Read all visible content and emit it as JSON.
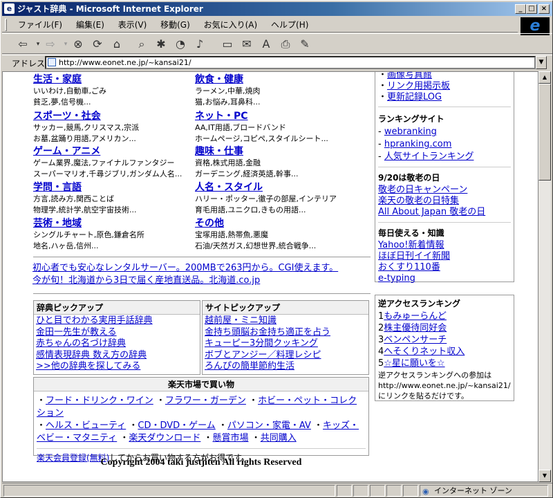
{
  "window": {
    "title": "ジャスト辞典 - Microsoft Internet Explorer",
    "min": "_",
    "max": "□",
    "close": "×"
  },
  "menu": [
    "ファイル(F)",
    "編集(E)",
    "表示(V)",
    "移動(G)",
    "お気に入り(A)",
    "ヘルプ(H)"
  ],
  "address": {
    "label": "アドレス",
    "url": "http://www.eonet.ne.jp/~kansai21/"
  },
  "categories": [
    {
      "title": "生活・家庭",
      "lines": [
        "いいわけ,自動車,ごみ",
        "貧乏,夢,信号機..."
      ]
    },
    {
      "title": "飲食・健康",
      "lines": [
        "ラーメン,中華,焼肉",
        "猫,お悩み,耳鼻科..."
      ]
    },
    {
      "title": "スポーツ・社会",
      "lines": [
        "サッカー,競馬,クリスマス,宗派",
        "お墓,盆踊り用語,アメリカン..."
      ]
    },
    {
      "title": "ネット・PC",
      "lines": [
        "AA,IT用語,ブロードバンド",
        "ホームページ,コピペ,スタイルシート..."
      ]
    },
    {
      "title": "ゲーム・アニメ",
      "lines": [
        "ゲーム業界,魔法,ファイナルファンタジー",
        "スーパーマリオ,千尋ジブリ,ガンダム人名..."
      ]
    },
    {
      "title": "趣味・仕事",
      "lines": [
        "資格,株式用語,金融",
        "ガーデニング,経済英語,幹事..."
      ]
    },
    {
      "title": "学問・言語",
      "lines": [
        "方言,読み方,関西ことば",
        "物理学,統計学,航空宇宙技術..."
      ]
    },
    {
      "title": "人名・スタイル",
      "lines": [
        "ハリー・ポッター,徹子の部屋,インテリア",
        "育毛用語,ユニクロ,きもの用語..."
      ]
    },
    {
      "title": "芸術・地域",
      "lines": [
        "シングルチャート,原色,鎌倉名所",
        "地名,ハヶ岳,信州..."
      ]
    },
    {
      "title": "その他",
      "lines": [
        "宝塚用語,熱帯魚,悪魔",
        "石油/天然ガス,幻想世界,統合戦争..."
      ]
    }
  ],
  "ads": [
    "初心者でも安心なレンタルサーバー。200MBで263円から。CGI使えます。",
    "今が旬！北海道から3日で届く産地直送品。北海道.co.jp"
  ],
  "dict_pickup": {
    "title": "辞典ピックアップ",
    "items": [
      "ひと目でわかる実用手話辞典",
      "金田一先生が教える",
      "赤ちゃんの名づけ辞典",
      "感情表現辞典 数え方の辞典",
      ">>他の辞典を探してみる"
    ]
  },
  "site_pickup": {
    "title": "サイトピックアップ",
    "items": [
      "越前屋・ミニ知識",
      "金持ち頭脳お金持ち適正を占う",
      "キューピー3分間クッキング",
      "ボブとアンジー／料理レシピ",
      "ろんぴの簡単節約生活"
    ]
  },
  "rakuten": {
    "title": "楽天市場で買い物",
    "links": [
      "フード・ドリンク・ワイン",
      "フラワー・ガーデン",
      "ホビー・ペット・コレクション",
      "ヘルス・ビューティ",
      "CD・DVD・ゲーム",
      "パソコン・家電・AV",
      "キッズ・ベビー・マタニティ",
      "楽天ダウンロード",
      "懸賞市場",
      "共同購入"
    ],
    "register_link": "楽天会員登録(無料)",
    "register_text": "してからお買い物する方がお得です。"
  },
  "copyright": "Copyright 2004 taki justjiten All rights Reserved",
  "side": {
    "top_links": [
      "画像写真館",
      "リンク用掲示板",
      "更新記録LOG"
    ],
    "ranking_title": "ランキングサイト",
    "ranking": [
      "webranking",
      "hpranking.com",
      "人気サイトランキング"
    ],
    "keiro_title": "9/20は敬老の日",
    "keiro": [
      "敬老の日キャンペーン",
      "楽天の敬老の日特集",
      "All About Japan 敬老の日"
    ],
    "daily_title": "毎日使える・知識",
    "daily": [
      "Yahoo!新着情報",
      "ほぼ日刊イイ新聞",
      "おくすり110番",
      "e-typing"
    ],
    "access_title": "逆アクセスランキング",
    "access": [
      "もみゅーらんど",
      "株主優待同好会",
      "ベンペンサーチ",
      "へそくりネット収入",
      "☆星に願いを☆"
    ],
    "access_nums": [
      "1",
      "2",
      "3",
      "4",
      "5"
    ],
    "access_note": "逆アクセスランキングへの参加は http://www.eonet.ne.jp/~kansai21/ にリンクを貼るだけです。"
  },
  "status": {
    "zone": "インターネット ゾーン"
  }
}
